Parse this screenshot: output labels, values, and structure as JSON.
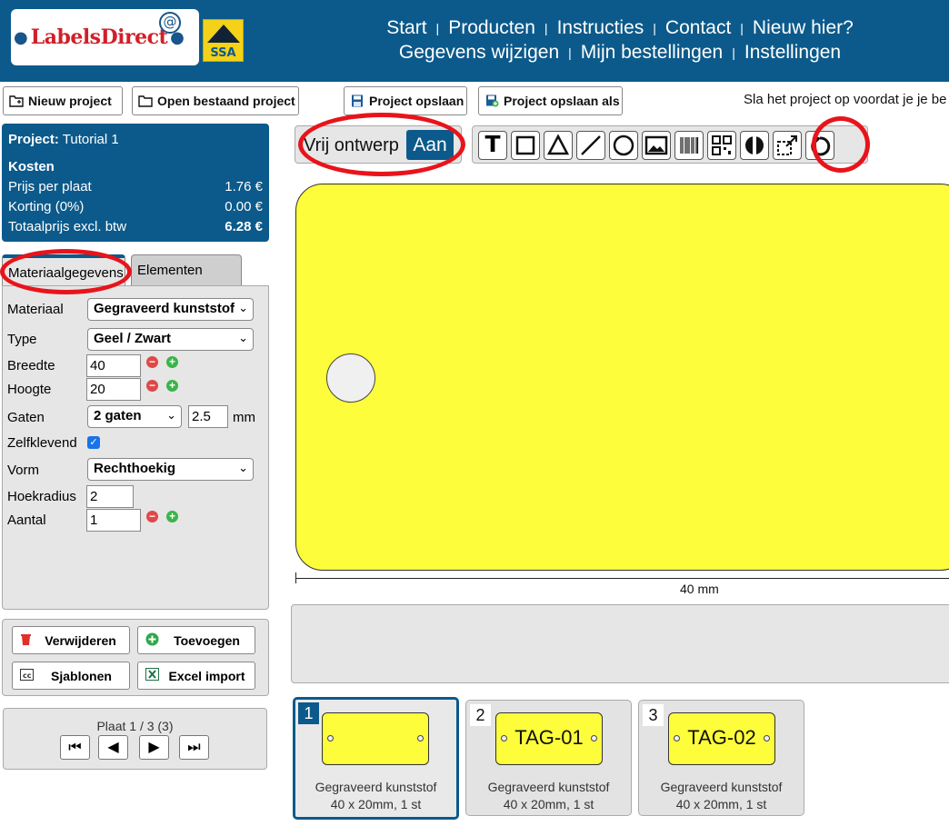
{
  "header": {
    "logo_text": "LabelsDirect",
    "logo_at": "@",
    "ssa_text": "SSA",
    "nav_row1": [
      "Start",
      "Producten",
      "Instructies",
      "Contact",
      "Nieuw hier?"
    ],
    "nav_row2": [
      "Gegevens wijzigen",
      "Mijn bestellingen",
      "Instellingen"
    ],
    "separator": "|"
  },
  "toolbar": {
    "new_project": "Nieuw project",
    "open_project": "Open bestaand project",
    "save_project": "Project opslaan",
    "save_project_as": "Project opslaan als",
    "hint": "Sla het project op voordat je je be"
  },
  "project": {
    "label": "Project:",
    "name": "Tutorial 1",
    "costs_title": "Kosten",
    "rows": [
      {
        "label": "Prijs per plaat",
        "value": "1.76 €"
      },
      {
        "label": "Korting (0%)",
        "value": "0.00 €"
      },
      {
        "label": "Totaalprijs excl. btw",
        "value": "6.28 €"
      }
    ]
  },
  "tabs": {
    "material": "Materiaalgegevens",
    "elements": "Elementen"
  },
  "form": {
    "material_label": "Materiaal",
    "material_value": "Gegraveerd kunststof",
    "type_label": "Type",
    "type_value": "Geel / Zwart",
    "width_label": "Breedte",
    "width_value": "40",
    "height_label": "Hoogte",
    "height_value": "20",
    "holes_label": "Gaten",
    "holes_value": "2 gaten",
    "hole_size": "2.5",
    "unit": "mm",
    "adhesive_label": "Zelfklevend",
    "shape_label": "Vorm",
    "shape_value": "Rechthoekig",
    "radius_label": "Hoekradius",
    "radius_value": "2",
    "count_label": "Aantal",
    "count_value": "1"
  },
  "actions": {
    "delete": "Verwijderen",
    "add": "Toevoegen",
    "templates": "Sjablonen",
    "excel_import": "Excel import"
  },
  "pager": {
    "label": "Plaat 1 / 3 (3)",
    "first": "⏮",
    "prev": "◀",
    "next": "▶",
    "last": "⏭"
  },
  "design": {
    "free_design_label": "Vrij ontwerp",
    "free_design_state": "Aan",
    "text_tool": "T",
    "dimension": "40 mm"
  },
  "thumbnails": [
    {
      "number": "1",
      "text": "",
      "material": "Gegraveerd kunststof",
      "size": "40 x 20mm, 1 st",
      "selected": true
    },
    {
      "number": "2",
      "text": "TAG-01",
      "material": "Gegraveerd kunststof",
      "size": "40 x 20mm, 1 st",
      "selected": false
    },
    {
      "number": "3",
      "text": "TAG-02",
      "material": "Gegraveerd kunststof",
      "size": "40 x 20mm, 1 st",
      "selected": false
    }
  ],
  "colors": {
    "brand_blue": "#0c5a8b",
    "label_yellow": "#fdfd3c",
    "annotation_red": "#e8141b"
  }
}
